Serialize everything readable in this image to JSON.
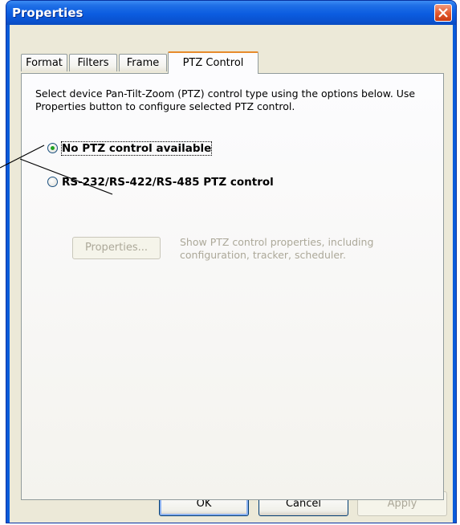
{
  "window": {
    "title": "Properties"
  },
  "tabs": [
    {
      "label": "Format"
    },
    {
      "label": "Filters"
    },
    {
      "label": "Frame"
    },
    {
      "label": "PTZ Control"
    }
  ],
  "panel": {
    "description": "Select device Pan-Tilt-Zoom (PTZ) control type using the options below. Use Properties button to configure selected PTZ control.",
    "options": [
      {
        "label": "No PTZ control available",
        "selected": true
      },
      {
        "label": "RS-232/RS-422/RS-485 PTZ control",
        "selected": false
      }
    ],
    "properties_button": {
      "label": "Properties...",
      "enabled": false
    },
    "properties_desc": "Show PTZ control properties, including configuration, tracker, scheduler."
  },
  "buttons": {
    "ok": "OK",
    "cancel": "Cancel",
    "apply": "Apply"
  },
  "colors": {
    "title_bar": "#0a5cda",
    "active_tab_accent": "#e68b2c",
    "selected_radio_dot": "#21a121",
    "disabled_text": "#aca899"
  }
}
